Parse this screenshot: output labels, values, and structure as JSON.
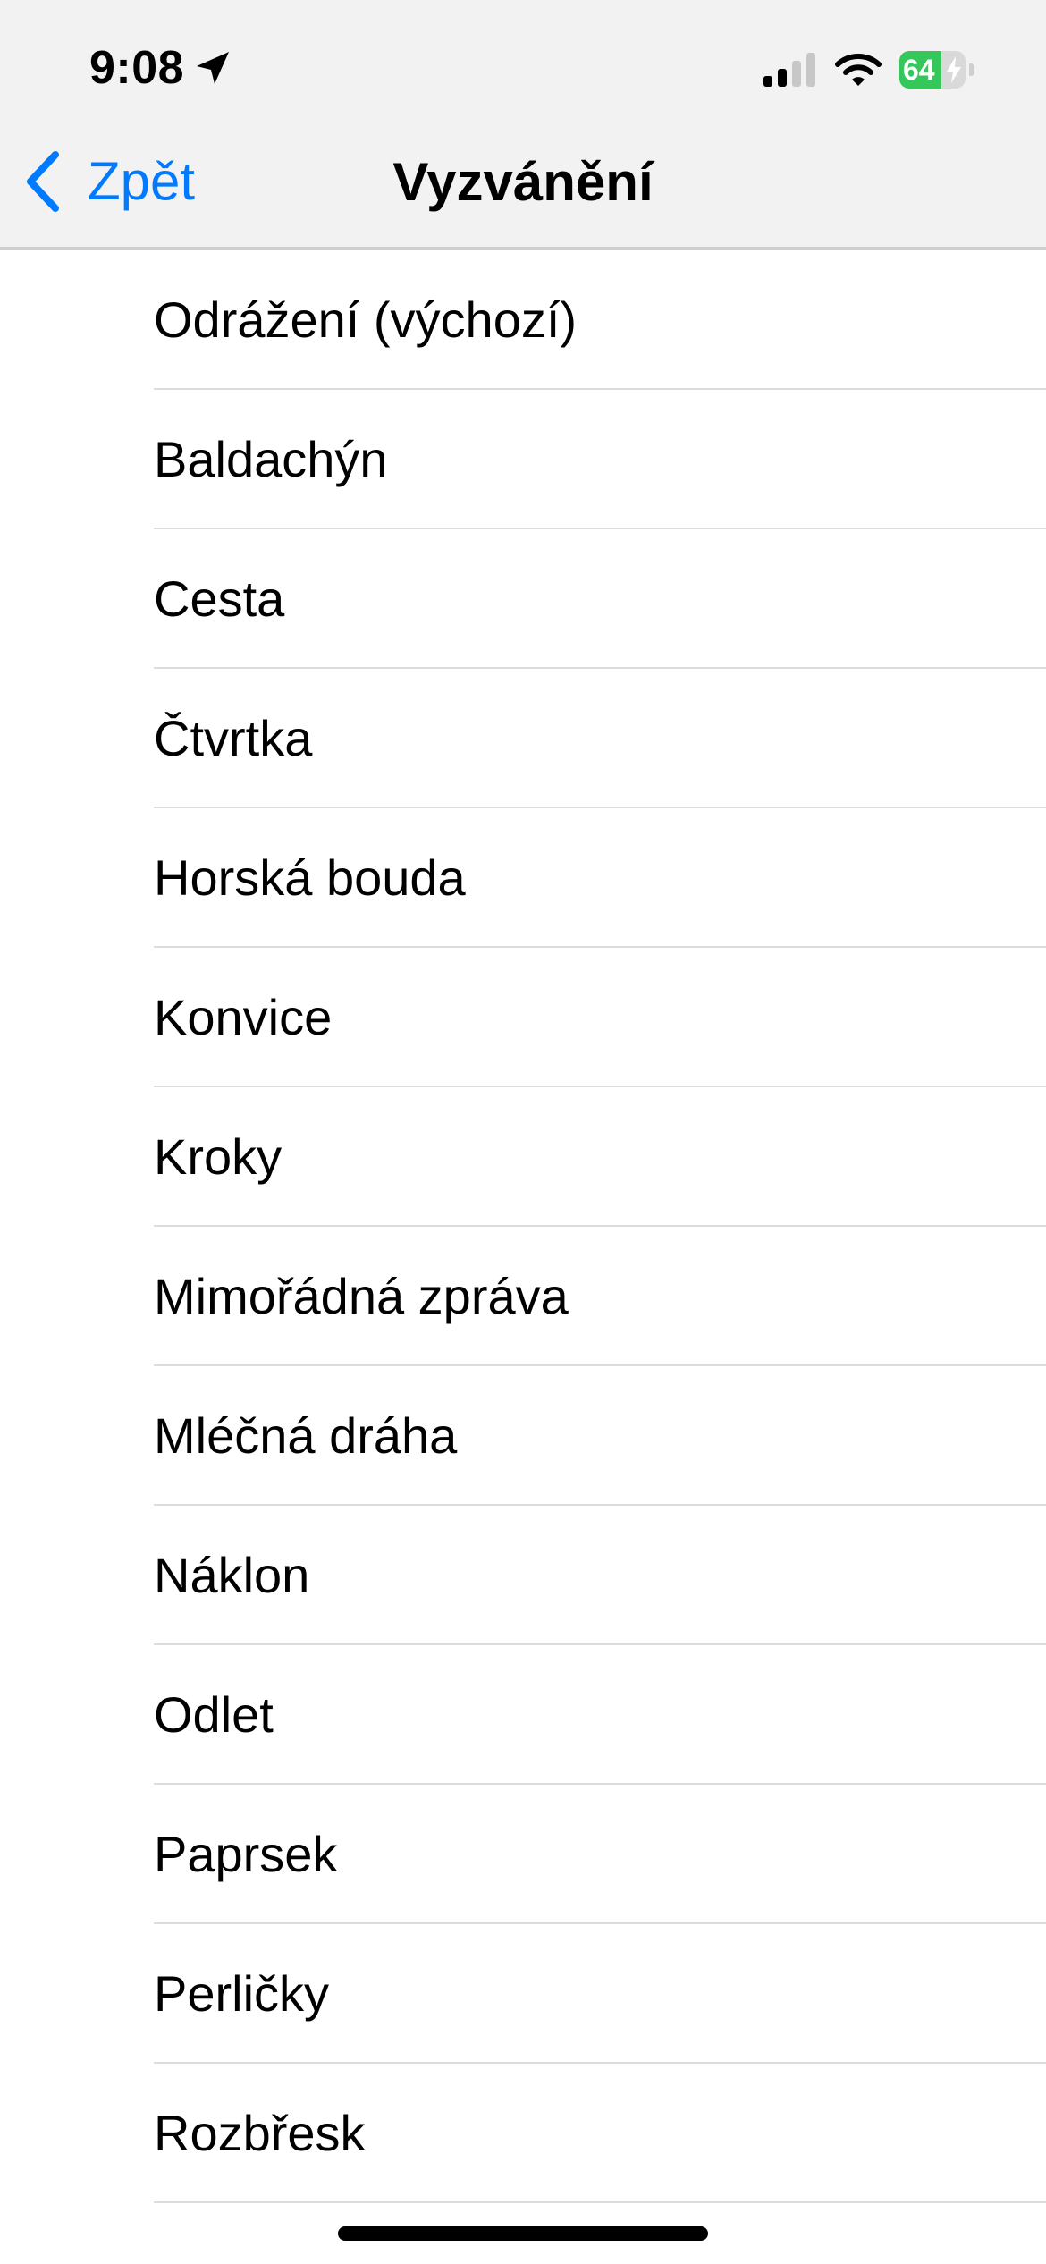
{
  "status_bar": {
    "time": "9:08",
    "location_icon": "location-arrow-icon",
    "signal_icon": "cellular-signal-icon",
    "signal_bars_active": 2,
    "signal_bars_total": 4,
    "wifi_icon": "wifi-icon",
    "battery_icon": "battery-charging-icon",
    "battery_percent": "64",
    "battery_level": 0.64,
    "battery_color": "#34c759"
  },
  "nav": {
    "back_icon": "chevron-left-icon",
    "back_label": "Zpět",
    "title": "Vyzvánění",
    "accent_color": "#007aff"
  },
  "ringtones": [
    {
      "label": "Odrážení (výchozí)"
    },
    {
      "label": "Baldachýn"
    },
    {
      "label": "Cesta"
    },
    {
      "label": "Čtvrtka"
    },
    {
      "label": "Horská bouda"
    },
    {
      "label": "Konvice"
    },
    {
      "label": "Kroky"
    },
    {
      "label": "Mimořádná zpráva"
    },
    {
      "label": "Mléčná dráha"
    },
    {
      "label": "Náklon"
    },
    {
      "label": "Odlet"
    },
    {
      "label": "Paprsek"
    },
    {
      "label": "Perličky"
    },
    {
      "label": "Rozbřesk"
    }
  ]
}
